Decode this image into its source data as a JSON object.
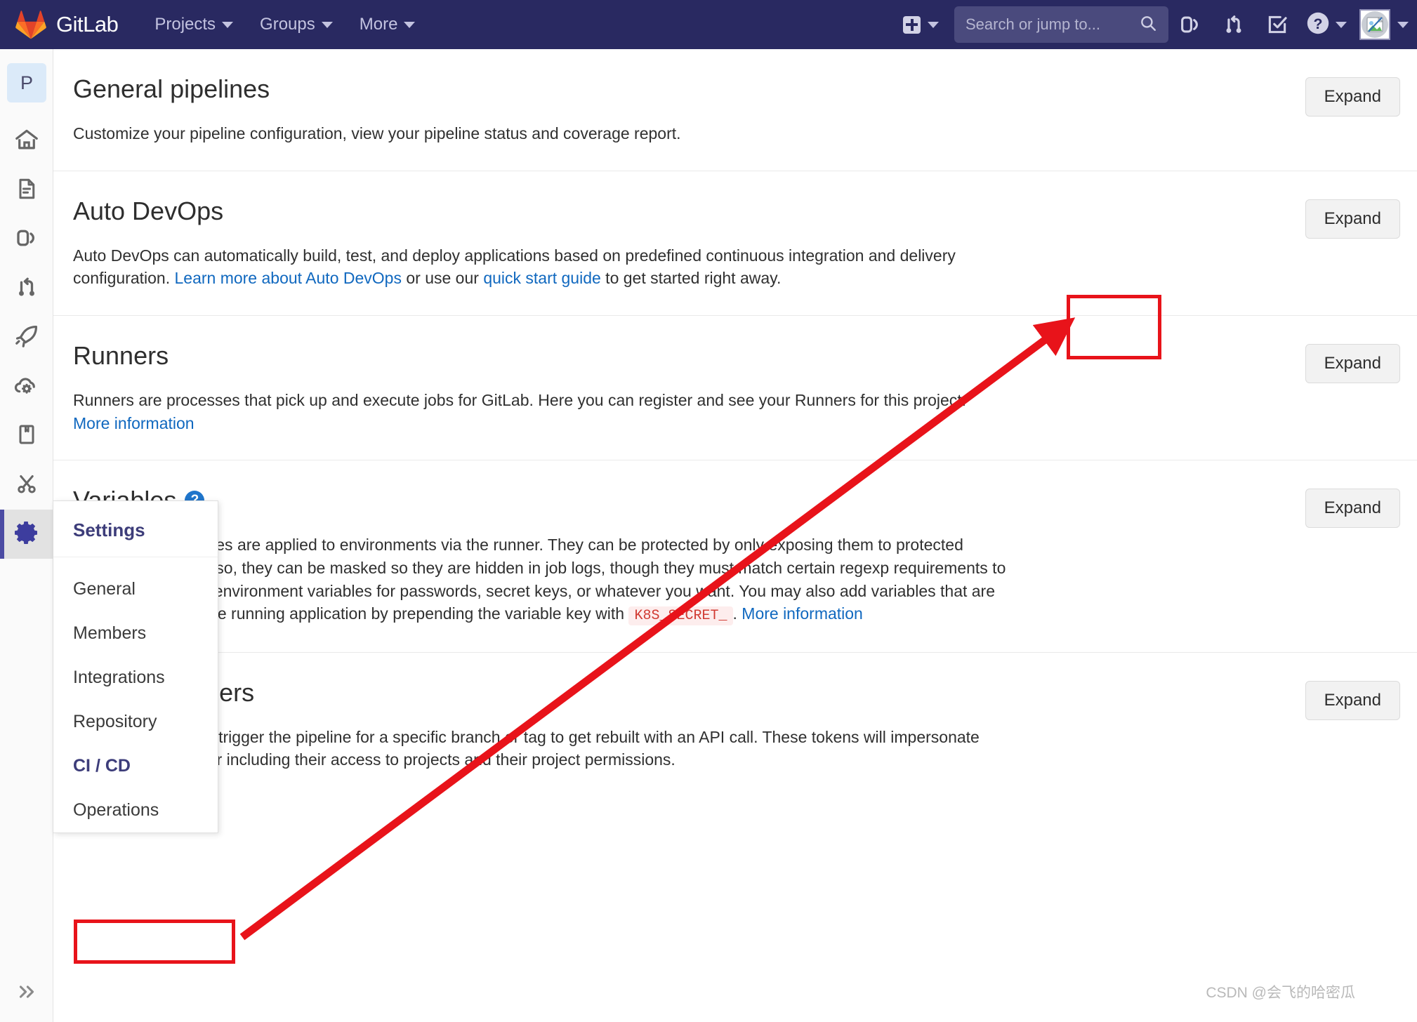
{
  "navbar": {
    "brand": "GitLab",
    "logo_icon": "gitlab-tanuki-icon",
    "links": [
      {
        "label": "Projects",
        "icon": "chevron-down-icon"
      },
      {
        "label": "Groups",
        "icon": "chevron-down-icon"
      },
      {
        "label": "More",
        "icon": "chevron-down-icon"
      }
    ],
    "new_dropdown": {
      "icon": "plus-square-icon",
      "caret": "chevron-down-icon"
    },
    "search": {
      "placeholder": "Search or jump to...",
      "value": "",
      "icon": "search-icon"
    },
    "icons": [
      {
        "name": "issues-icon",
        "title": "Issues"
      },
      {
        "name": "merge-requests-icon",
        "title": "Merge requests"
      },
      {
        "name": "todos-icon",
        "title": "To-Do List"
      },
      {
        "name": "help-icon",
        "title": "Help"
      }
    ],
    "avatar": {
      "name": "user-avatar",
      "state": "broken-image"
    }
  },
  "rail": {
    "project_initial": "P",
    "items": [
      {
        "name": "project-avatar",
        "label": "P"
      },
      {
        "name": "project-overview-icon",
        "label": "Project overview"
      },
      {
        "name": "repository-icon",
        "label": "Repository"
      },
      {
        "name": "issues-icon",
        "label": "Issues"
      },
      {
        "name": "merge-requests-icon",
        "label": "Merge Requests"
      },
      {
        "name": "cicd-rocket-icon",
        "label": "CI / CD"
      },
      {
        "name": "operations-cloud-icon",
        "label": "Operations"
      },
      {
        "name": "wiki-book-icon",
        "label": "Wiki"
      },
      {
        "name": "snippets-scissors-icon",
        "label": "Snippets"
      },
      {
        "name": "settings-gear-icon",
        "label": "Settings",
        "active": true
      }
    ],
    "collapse": {
      "name": "collapse-sidebar-icon",
      "label": "Collapse sidebar"
    }
  },
  "sections": [
    {
      "id": "general-pipelines",
      "title": "General pipelines",
      "desc_plain": "Customize your pipeline configuration, view your pipeline status and coverage report.",
      "expand_label": "Expand"
    },
    {
      "id": "auto-devops",
      "title": "Auto DevOps",
      "desc_part1": "Auto DevOps can automatically build, test, and deploy applications based on predefined continuous integration and delivery configuration. ",
      "link1": "Learn more about Auto DevOps",
      "desc_part2": " or use our ",
      "link2": "quick start guide",
      "desc_part3": " to get started right away.",
      "expand_label": "Expand"
    },
    {
      "id": "runners",
      "title": "Runners",
      "desc_part1": "Runners are processes that pick up and execute jobs for GitLab. Here you can register and see your Runners for this project. ",
      "link1": "More information",
      "expand_label": "Expand"
    },
    {
      "id": "variables",
      "title": "Variables",
      "help_icon": "question-circle-icon",
      "desc_part1": "Environment variables are applied to environments via the runner. They can be protected by only exposing them to protected branches or tags. Also, they can be masked so they are hidden in job logs, though they must match certain regexp requirements to do so. You can use environment variables for passwords, secret keys, or whatever you want. You may also add variables that are made available to the running application by prepending the variable key with ",
      "code_chip": "K8S_SECRET_",
      "desc_part2": ". ",
      "link1": "More information",
      "expand_label": "Expand"
    },
    {
      "id": "pipeline-triggers",
      "title": "Pipeline triggers",
      "desc_part1": "Add an easy way to trigger the pipeline for a specific branch or tag to get rebuilt with an API call. These tokens will impersonate their associated user including their access to projects and their project permissions.",
      "expand_label": "Expand"
    }
  ],
  "flyout": {
    "header": "Settings",
    "items": [
      {
        "label": "General",
        "active": false
      },
      {
        "label": "Members",
        "active": false
      },
      {
        "label": "Integrations",
        "active": false
      },
      {
        "label": "Repository",
        "active": false
      },
      {
        "label": "CI / CD",
        "active": true
      },
      {
        "label": "Operations",
        "active": false
      }
    ]
  },
  "annotations": {
    "color": "#e8131a",
    "box_expand_target": "runners-expand-button",
    "box_menu_target": "flyout-item-ci-cd",
    "arrow": "arrow-from-ci-cd-to-runners-expand"
  },
  "watermark": "CSDN @会飞的哈密瓜"
}
